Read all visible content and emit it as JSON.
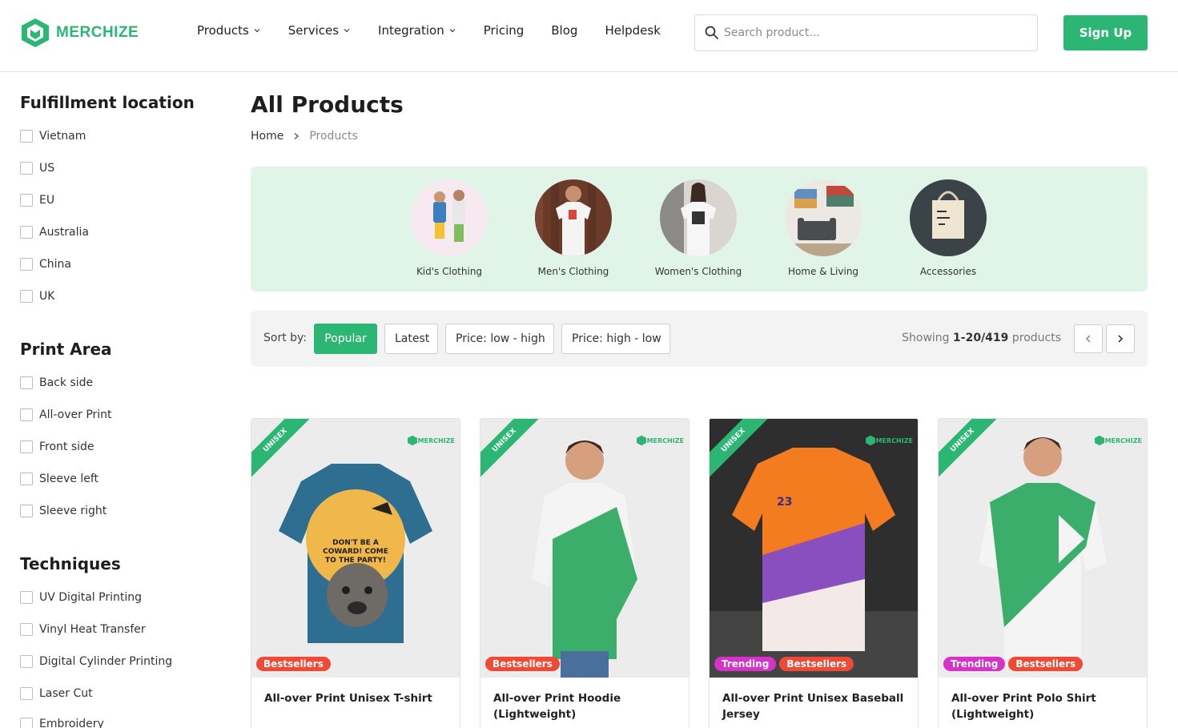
{
  "header": {
    "logo_text": "MERCHIZE",
    "nav": [
      {
        "label": "Products",
        "has_dropdown": true
      },
      {
        "label": "Services",
        "has_dropdown": true
      },
      {
        "label": "Integration",
        "has_dropdown": true
      },
      {
        "label": "Pricing",
        "has_dropdown": false
      },
      {
        "label": "Blog",
        "has_dropdown": false
      },
      {
        "label": "Helpdesk",
        "has_dropdown": false
      }
    ],
    "search_placeholder": "Search product...",
    "signup_label": "Sign Up"
  },
  "colors": {
    "brand": "#2bb673",
    "category_bg": "#e0f5e7",
    "bestseller": "#ef4a36",
    "trending": "#d632c9"
  },
  "sidebar": {
    "sections": [
      {
        "title": "Fulfillment location",
        "items": [
          "Vietnam",
          "US",
          "EU",
          "Australia",
          "China",
          "UK"
        ]
      },
      {
        "title": "Print Area",
        "items": [
          "Back side",
          "All-over Print",
          "Front side",
          "Sleeve left",
          "Sleeve right"
        ]
      },
      {
        "title": "Techniques",
        "items": [
          "UV Digital Printing",
          "Vinyl Heat Transfer",
          "Digital Cylinder Printing",
          "Laser Cut",
          "Embroidery"
        ]
      }
    ]
  },
  "main": {
    "title": "All Products",
    "breadcrumb": {
      "home": "Home",
      "current": "Products"
    },
    "categories": [
      "Kid's Clothing",
      "Men's Clothing",
      "Women's Clothing",
      "Home & Living",
      "Accessories"
    ],
    "sort": {
      "label": "Sort by:",
      "options": [
        "Popular",
        "Latest",
        "Price: low - high",
        "Price: high - low"
      ],
      "active": "Popular"
    },
    "showing": {
      "prefix": "Showing",
      "range": "1-20/419",
      "suffix": "products"
    },
    "products": [
      {
        "title": "All-over Print Unisex T-shirt",
        "ribbon": "UNISEX",
        "brand": "MERCHIZE",
        "badges": [
          "Bestsellers"
        ],
        "shirt_text": "DON'T BE A COWARD! COME TO THE PARTY!"
      },
      {
        "title": "All-over Print Hoodie (Lightweight)",
        "ribbon": "UNISEX",
        "brand": "MERCHIZE",
        "badges": [
          "Bestsellers"
        ]
      },
      {
        "title": "All-over Print Unisex Baseball Jersey",
        "ribbon": "UNISEX",
        "brand": "MERCHIZE",
        "badges": [
          "Trending",
          "Bestsellers"
        ],
        "jersey_number": "23"
      },
      {
        "title": "All-over Print Polo Shirt (Lightweight)",
        "ribbon": "UNISEX",
        "brand": "MERCHIZE",
        "badges": [
          "Trending",
          "Bestsellers"
        ]
      }
    ]
  }
}
